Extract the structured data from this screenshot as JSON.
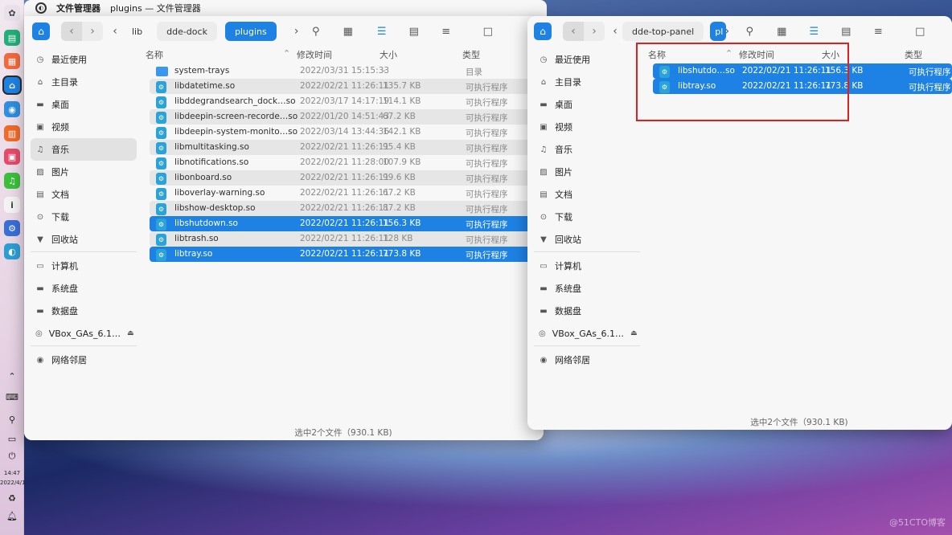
{
  "dock": {
    "clock_time": "14:47",
    "clock_date": "2022/4/1",
    "apps": [
      {
        "name": "launcher-icon",
        "glyph": "✿",
        "color": "#e8e0ea"
      },
      {
        "name": "terminal-icon",
        "glyph": "▤",
        "color": "#22b07a"
      },
      {
        "name": "app-store-icon",
        "glyph": "▦",
        "color": "#f26a3d"
      },
      {
        "name": "file-manager-icon",
        "glyph": "⌂",
        "color": "#1e82e4"
      },
      {
        "name": "browser-icon",
        "glyph": "◉",
        "color": "#2f8fe0"
      },
      {
        "name": "calendar-icon",
        "glyph": "▥",
        "color": "#f06a2a"
      },
      {
        "name": "photos-icon",
        "glyph": "▣",
        "color": "#e84a6a"
      },
      {
        "name": "music-icon",
        "glyph": "♫",
        "color": "#3cc03c"
      },
      {
        "name": "info-icon",
        "glyph": "i",
        "color": "#f4f4f4"
      },
      {
        "name": "settings-icon",
        "glyph": "⚙",
        "color": "#3a6fd8"
      },
      {
        "name": "edge-icon",
        "glyph": "◐",
        "color": "#2a9fd6"
      }
    ]
  },
  "titlebar": {
    "app_name": "文件管理器",
    "window_title": "plugins — 文件管理器"
  },
  "sidebar": {
    "items": [
      "最近使用",
      "主目录",
      "桌面",
      "视频",
      "音乐",
      "图片",
      "文档",
      "下载",
      "回收站"
    ],
    "devices": [
      "计算机",
      "系统盘",
      "数据盘",
      "VBox_GAs_6.1…"
    ],
    "network": "网络邻居"
  },
  "columns": {
    "name": "名称",
    "modified": "修改时间",
    "size": "大小",
    "type": "类型"
  },
  "window1": {
    "breadcrumbs": [
      "lib",
      "dde-dock",
      "plugins"
    ],
    "status": "选中2个文件（930.1 KB)",
    "files": [
      {
        "name": "system-trays",
        "date": "2022/03/31 15:15:33",
        "size": "-",
        "type": "目录",
        "folder": true,
        "selected": false
      },
      {
        "name": "libdatetime.so",
        "date": "2022/02/21 11:26:11",
        "size": "135.7 KB",
        "type": "可执行程序",
        "selected": false
      },
      {
        "name": "libddegrandsearch_dock…so",
        "date": "2022/03/17 14:17:19",
        "size": "114.1 KB",
        "type": "可执行程序",
        "selected": false
      },
      {
        "name": "libdeepin-screen-recorde…so",
        "date": "2022/01/20 14:51:43",
        "size": "67.2 KB",
        "type": "可执行程序",
        "selected": false
      },
      {
        "name": "libdeepin-system-monito…so",
        "date": "2022/03/14 13:44:36",
        "size": "142.1 KB",
        "type": "可执行程序",
        "selected": false
      },
      {
        "name": "libmultitasking.so",
        "date": "2022/02/21 11:26:11",
        "size": "95.4 KB",
        "type": "可执行程序",
        "selected": false
      },
      {
        "name": "libnotifications.so",
        "date": "2022/02/21 11:28:00",
        "size": "107.9 KB",
        "type": "可执行程序",
        "selected": false
      },
      {
        "name": "libonboard.so",
        "date": "2022/02/21 11:26:11",
        "size": "99.6 KB",
        "type": "可执行程序",
        "selected": false
      },
      {
        "name": "liboverlay-warning.so",
        "date": "2022/02/21 11:26:11",
        "size": "67.2 KB",
        "type": "可执行程序",
        "selected": false
      },
      {
        "name": "libshow-desktop.so",
        "date": "2022/02/21 11:26:11",
        "size": "87.2 KB",
        "type": "可执行程序",
        "selected": false
      },
      {
        "name": "libshutdown.so",
        "date": "2022/02/21 11:26:11",
        "size": "156.3 KB",
        "type": "可执行程序",
        "selected": true
      },
      {
        "name": "libtrash.so",
        "date": "2022/02/21 11:26:11",
        "size": "128 KB",
        "type": "可执行程序",
        "selected": false
      },
      {
        "name": "libtray.so",
        "date": "2022/02/21 11:26:11",
        "size": "773.8 KB",
        "type": "可执行程序",
        "selected": true
      }
    ]
  },
  "window2": {
    "breadcrumbs": [
      "dde-top-panel",
      "pl"
    ],
    "status": "选中2个文件（930.1 KB)",
    "files": [
      {
        "name": "libshutdo…so",
        "date": "2022/02/21 11:26:11",
        "size": "156.3 KB",
        "type": "可执行程序",
        "selected": true
      },
      {
        "name": "libtray.so",
        "date": "2022/02/21 11:26:11",
        "size": "773.8 KB",
        "type": "可执行程序",
        "selected": true
      }
    ]
  },
  "watermark": "@51CTO博客",
  "colors": {
    "accent": "#1e82e4",
    "highlight_box": "#e02020"
  }
}
